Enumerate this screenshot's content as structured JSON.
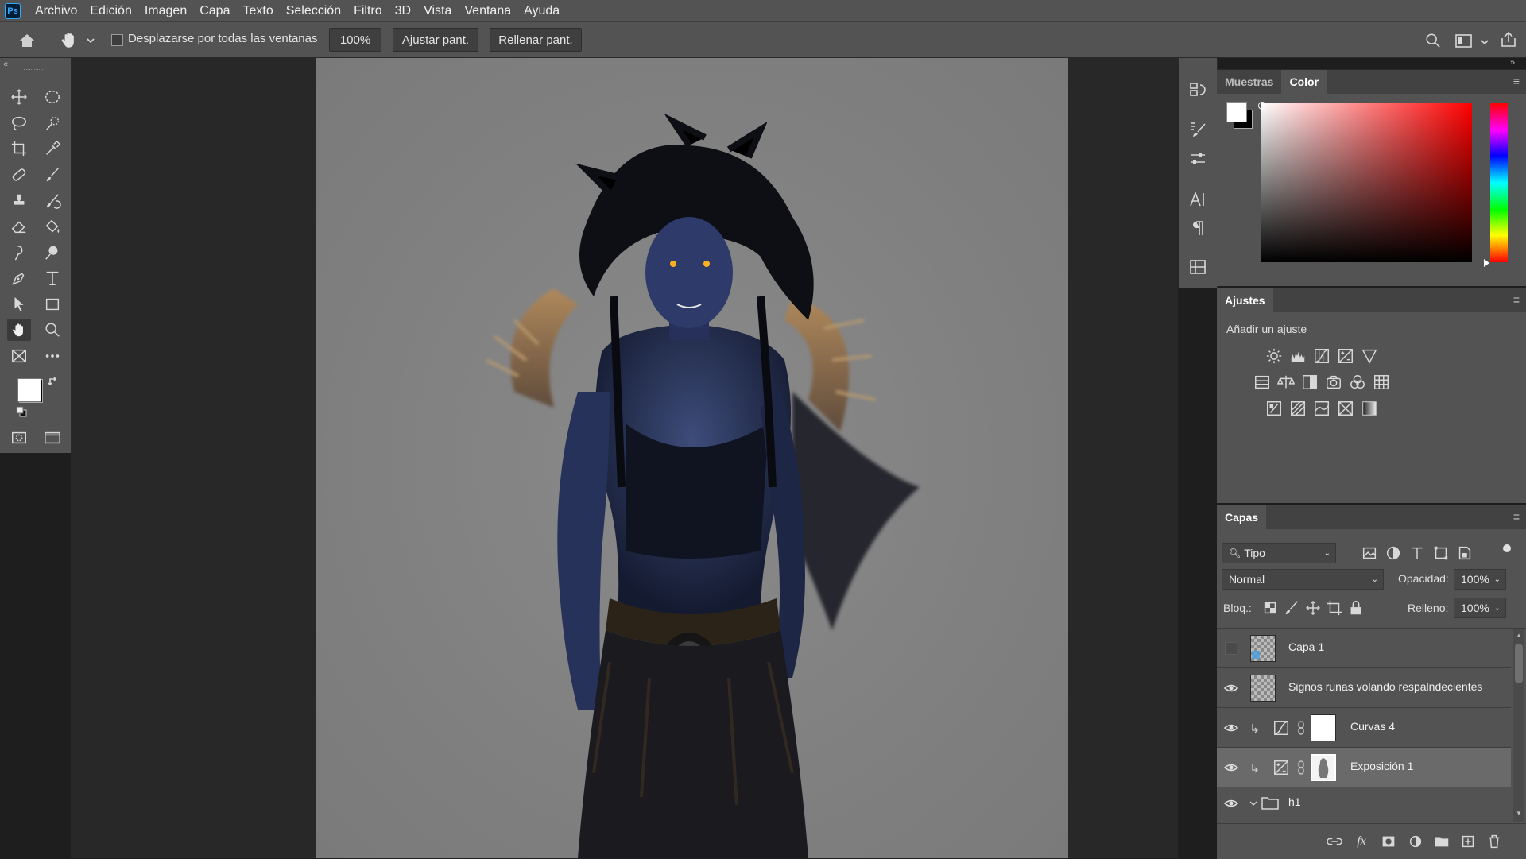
{
  "app": {
    "logo_text": "Ps"
  },
  "menu": [
    "Archivo",
    "Edición",
    "Imagen",
    "Capa",
    "Texto",
    "Selección",
    "Filtro",
    "3D",
    "Vista",
    "Ventana",
    "Ayuda"
  ],
  "options": {
    "scroll_all_label": "Desplazarse por todas las ventanas",
    "zoom": "100%",
    "fit_screen": "Ajustar pant.",
    "fill_screen": "Rellenar pant."
  },
  "color_panel": {
    "tabs": [
      "Muestras",
      "Color"
    ],
    "active_tab": "Color",
    "foreground": "#ffffff",
    "background": "#000000",
    "hue_color": "#ff0000"
  },
  "adjustments": {
    "title": "Ajustes",
    "subtitle": "Añadir un ajuste"
  },
  "layers": {
    "title": "Capas",
    "filter_type": "Tipo",
    "blend_mode": "Normal",
    "opacity_label": "Opacidad:",
    "opacity": "100%",
    "lock_label": "Bloq.:",
    "fill_label": "Relleno:",
    "fill": "100%",
    "items": [
      {
        "name": "Capa 1",
        "visible": false
      },
      {
        "name": "Signos runas volando respalndecientes",
        "visible": true
      },
      {
        "name": "Curvas 4",
        "visible": true
      },
      {
        "name": "Exposición 1",
        "visible": true,
        "selected": true
      },
      {
        "name": "h1",
        "visible": true
      }
    ]
  }
}
